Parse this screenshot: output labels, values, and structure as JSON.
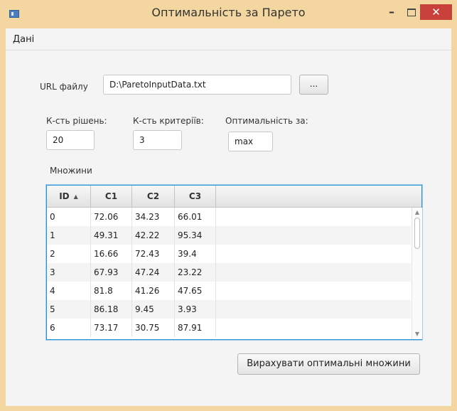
{
  "window": {
    "title": "Оптимальність за Парето",
    "minimize_glyph": "–",
    "close_glyph": "✕"
  },
  "menu": {
    "items": [
      "Дані"
    ]
  },
  "file": {
    "label": "URL файлу",
    "value": "D:\\ParetoInputData.txt",
    "browse_label": "..."
  },
  "params": {
    "solutions_label": "К-сть рішень:",
    "solutions_value": "20",
    "criteria_label": "К-сть критеріїв:",
    "criteria_value": "3",
    "optimality_label": "Оптимальність за:",
    "optimality_value": "max"
  },
  "sets": {
    "label": "Множини",
    "columns": [
      "ID",
      "C1",
      "C2",
      "C3"
    ],
    "sort_icon": "▲",
    "rows": [
      [
        "0",
        "72.06",
        "34.23",
        "66.01"
      ],
      [
        "1",
        "49.31",
        "42.22",
        "95.34"
      ],
      [
        "2",
        "16.66",
        "72.43",
        "39.4"
      ],
      [
        "3",
        "67.93",
        "47.24",
        "23.22"
      ],
      [
        "4",
        "81.8",
        "41.26",
        "47.65"
      ],
      [
        "5",
        "86.18",
        "9.45",
        "3.93"
      ],
      [
        "6",
        "73.17",
        "30.75",
        "87.91"
      ]
    ]
  },
  "actions": {
    "compute_label": "Вирахувати оптимальні множини"
  },
  "colors": {
    "frame": "#f3d6a0",
    "close": "#c7403a",
    "table_focus": "#2a93d5"
  }
}
